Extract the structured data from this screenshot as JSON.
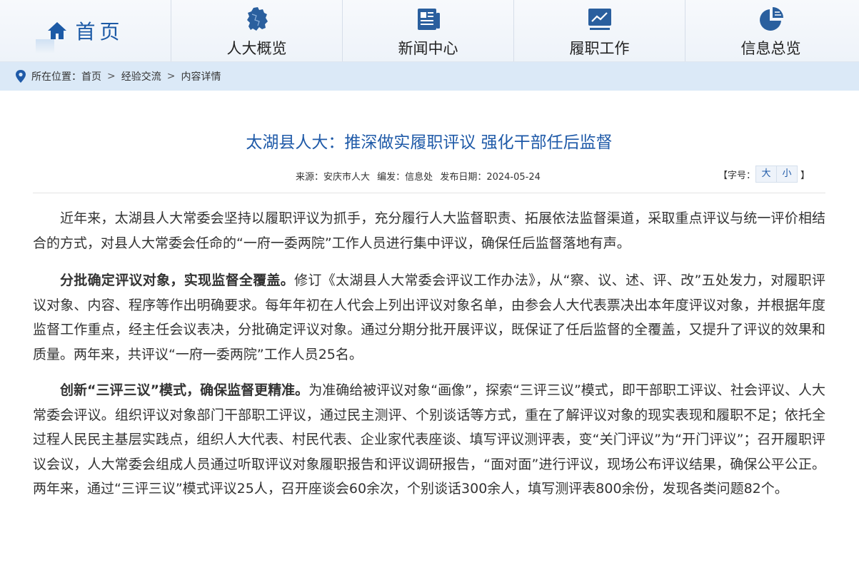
{
  "nav": {
    "home_label": "首页",
    "items": [
      {
        "label": "人大概览",
        "icon": "map-icon"
      },
      {
        "label": "新闻中心",
        "icon": "newspaper-icon"
      },
      {
        "label": "履职工作",
        "icon": "chart-screen-icon"
      },
      {
        "label": "信息总览",
        "icon": "pie-chart-icon"
      }
    ]
  },
  "breadcrumb": {
    "prefix": "所在位置：",
    "items": [
      "首页",
      "经验交流",
      "内容详情"
    ],
    "separator": ">"
  },
  "article": {
    "title": "太湖县人大：推深做实履职评议 强化干部任后监督",
    "source": "来源：安庆市人大",
    "editor": "编发：信息处",
    "date": "发布日期：2024-05-24",
    "fontsize_label": "【字号：",
    "fontsize_large": "大",
    "fontsize_small": "小",
    "fontsize_close": "】",
    "paragraphs": [
      {
        "bold": "",
        "text": "近年来，太湖县人大常委会坚持以履职评议为抓手，充分履行人大监督职责、拓展依法监督渠道，采取重点评议与统一评价相结合的方式，对县人大常委会任命的“一府一委两院”工作人员进行集中评议，确保任后监督落地有声。"
      },
      {
        "bold": "分批确定评议对象，实现监督全覆盖。",
        "text": "修订《太湖县人大常委会评议工作办法》，从“察、议、述、评、改”五处发力，对履职评议对象、内容、程序等作出明确要求。每年年初在人代会上列出评议对象名单，由参会人大代表票决出本年度评议对象，并根据年度监督工作重点，经主任会议表决，分批确定评议对象。通过分期分批开展评议，既保证了任后监督的全覆盖，又提升了评议的效果和质量。两年来，共评议“一府一委两院”工作人员25名。"
      },
      {
        "bold": "创新“三评三议”模式，确保监督更精准。",
        "text": "为准确给被评议对象“画像”，探索“三评三议”模式，即干部职工评议、社会评议、人大常委会评议。组织评议对象部门干部职工评议，通过民主测评、个别谈话等方式，重在了解评议对象的现实表现和履职不足；依托全过程人民民主基层实践点，组织人大代表、村民代表、企业家代表座谈、填写评议测评表，变“关门评议”为“开门评议”；召开履职评议会议，人大常委会组成人员通过听取评议对象履职报告和评议调研报告，“面对面”进行评议，现场公布评议结果，确保公平公正。两年来，通过“三评三议”模式评议25人，召开座谈会60余次，个别谈话300余人，填写测评表800余份，发现各类问题82个。"
      }
    ]
  },
  "colors": {
    "brand_blue": "#1f5aa8",
    "crumb_bg": "#dbe9f7"
  }
}
